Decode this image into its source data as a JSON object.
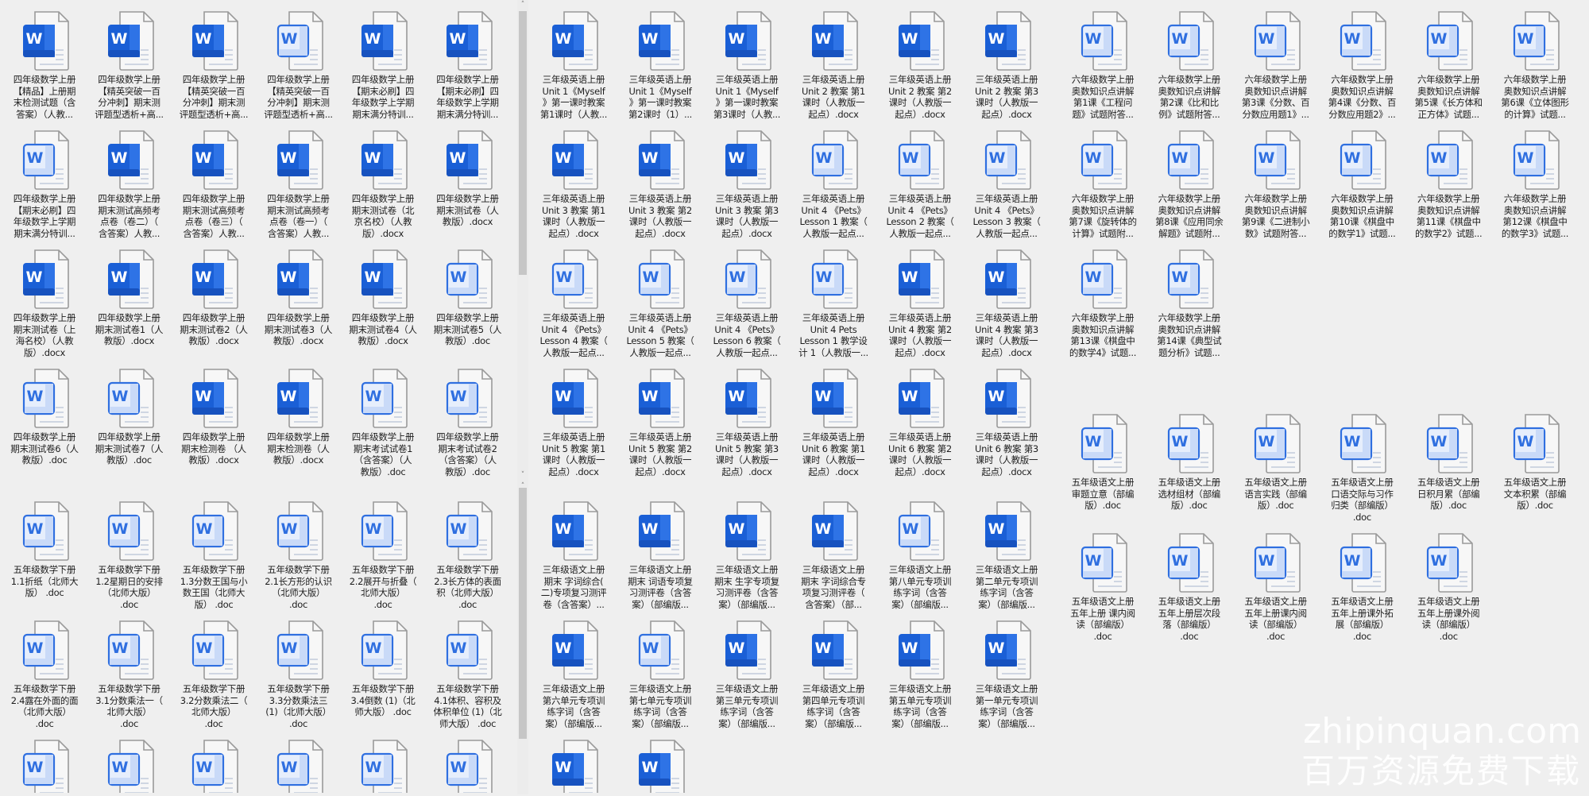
{
  "colors": {
    "background": "#efefef",
    "word_blue": "#1a5fd6",
    "word_blue_light": "#c9daf8",
    "outline_blue": "#2f6fe0"
  },
  "panes": [
    {
      "name": "left-top-pane",
      "rows": [
        [
          {
            "label": "四年级数学上册\n【精品】上册期\n末检测试题（含\n答案）（人教...",
            "icon": "word-solid-icon"
          },
          {
            "label": "四年级数学上册\n【精英突破一百\n分冲刺】期末测\n评题型透析+高...",
            "icon": "word-solid-icon"
          },
          {
            "label": "四年级数学上册\n【精英突破一百\n分冲刺】期末测\n评题型透析+高...",
            "icon": "word-solid-icon"
          },
          {
            "label": "四年级数学上册\n【精英突破一百\n分冲刺】期末测\n评题型透析+高...",
            "icon": "word-outline-icon"
          },
          {
            "label": "四年级数学上册\n【期末必刷】四\n年级数学上学期\n期末满分特训...",
            "icon": "word-solid-icon"
          },
          {
            "label": "四年级数学上册\n【期末必刷】四\n年级数学上学期\n期末满分特训...",
            "icon": "word-solid-icon"
          }
        ],
        [
          {
            "label": "四年级数学上册\n【期末必刷】四\n年级数学上学期\n期末满分特训...",
            "icon": "word-outline-icon"
          },
          {
            "label": "四年级数学上册\n期末测试高频考\n点卷（卷二）（\n含答案）人教...",
            "icon": "word-solid-icon"
          },
          {
            "label": "四年级数学上册\n期末测试高频考\n点卷（卷三）（\n含答案）人教...",
            "icon": "word-solid-icon"
          },
          {
            "label": "四年级数学上册\n期末测试高频考\n点卷（卷一）（\n含答案）人教...",
            "icon": "word-solid-icon"
          },
          {
            "label": "四年级数学上册\n期末测试卷（北\n京名校）（人教\n版）.docx",
            "icon": "word-solid-icon"
          },
          {
            "label": "四年级数学上册\n期末测试卷（人\n教版）.docx",
            "icon": "word-solid-icon"
          }
        ],
        [
          {
            "label": "四年级数学上册\n期末测试卷（上\n海名校）（人教\n版）.docx",
            "icon": "word-solid-icon"
          },
          {
            "label": "四年级数学上册\n期末测试卷1（人\n教版）.docx",
            "icon": "word-solid-icon"
          },
          {
            "label": "四年级数学上册\n期末测试卷2（人\n教版）.docx",
            "icon": "word-solid-icon"
          },
          {
            "label": "四年级数学上册\n期末测试卷3（人\n教版）.docx",
            "icon": "word-solid-icon"
          },
          {
            "label": "四年级数学上册\n期末测试卷4（人\n教版）.docx",
            "icon": "word-solid-icon"
          },
          {
            "label": "四年级数学上册\n期末测试卷5（人\n教版）.doc",
            "icon": "word-outline-icon"
          }
        ],
        [
          {
            "label": "四年级数学上册\n期末测试卷6（人\n教版）.doc",
            "icon": "word-outline-icon"
          },
          {
            "label": "四年级数学上册\n期末测试卷7（人\n教版）.doc",
            "icon": "word-outline-icon"
          },
          {
            "label": "四年级数学上册\n期末检测卷 （人\n教版）.docx",
            "icon": "word-solid-icon"
          },
          {
            "label": "四年级数学上册\n期末检测卷（人\n教版）.docx",
            "icon": "word-solid-icon"
          },
          {
            "label": "四年级数学上册\n期末考试试卷1\n（含答案）（人\n教版）.doc",
            "icon": "word-outline-icon"
          },
          {
            "label": "四年级数学上册\n期末考试试卷2\n（含答案）（人\n教版）.doc",
            "icon": "word-outline-icon"
          }
        ]
      ]
    },
    {
      "name": "left-bottom-pane",
      "rows": [
        [
          {
            "label": "五年级数学下册\n1.1折纸（北师大\n版） .doc",
            "icon": "word-outline-icon"
          },
          {
            "label": "五年级数学下册\n1.2星期日的安排\n（北师大版）\n.doc",
            "icon": "word-outline-icon"
          },
          {
            "label": "五年级数学下册\n1.3分数王国与小\n数王国（北师大\n版） .doc",
            "icon": "word-outline-icon"
          },
          {
            "label": "五年级数学下册\n2.1长方形的认识\n（北师大版）\n.doc",
            "icon": "word-outline-icon"
          },
          {
            "label": "五年级数学下册\n2.2展开与折叠（\n北师大版）\n.doc",
            "icon": "word-outline-icon"
          },
          {
            "label": "五年级数学下册\n2.3长方体的表面\n积（北师大版）\n.doc",
            "icon": "word-outline-icon"
          }
        ],
        [
          {
            "label": "五年级数学下册\n2.4露在外面的面\n（北师大版）\n.doc",
            "icon": "word-outline-icon"
          },
          {
            "label": "五年级数学下册\n3.1分数乘法一（\n北师大版）\n.doc",
            "icon": "word-outline-icon"
          },
          {
            "label": "五年级数学下册\n3.2分数乘法二（\n北师大版）\n.doc",
            "icon": "word-outline-icon"
          },
          {
            "label": "五年级数学下册\n3.3分数乘法三\n(1)（北师大版）\n.doc",
            "icon": "word-outline-icon"
          },
          {
            "label": "五年级数学下册\n3.4倒数 (1)（北\n师大版） .doc",
            "icon": "word-outline-icon"
          },
          {
            "label": "五年级数学下册\n4.1体积、容积及\n体积单位 (1)（北\n师大版） .doc",
            "icon": "word-outline-icon"
          }
        ],
        [
          {
            "icon": "word-outline-icon"
          },
          {
            "icon": "word-outline-icon"
          },
          {
            "icon": "word-outline-icon"
          },
          {
            "icon": "word-outline-icon"
          },
          {
            "icon": "word-outline-icon"
          },
          {
            "icon": "word-outline-icon"
          }
        ]
      ]
    },
    {
      "name": "middle-top-pane",
      "rows": [
        [
          {
            "label": "三年级英语上册\nUnit 1《Myself\n》第一课时教案\n第1课时（人教...",
            "icon": "word-solid-icon"
          },
          {
            "label": "三年级英语上册\nUnit 1《Myself\n》第一课时教案\n第2课时（1）...",
            "icon": "word-solid-icon"
          },
          {
            "label": "三年级英语上册\nUnit 1《Myself\n》第一课时教案\n第3课时（人教...",
            "icon": "word-solid-icon"
          },
          {
            "label": "三年级英语上册\nUnit 2 教案 第1\n课时（人教版一\n起点）.docx",
            "icon": "word-solid-icon"
          },
          {
            "label": "三年级英语上册\nUnit 2 教案 第2\n课时（人教版一\n起点）.docx",
            "icon": "word-solid-icon"
          },
          {
            "label": "三年级英语上册\nUnit 2 教案 第3\n课时（人教版一\n起点）.docx",
            "icon": "word-solid-icon"
          }
        ],
        [
          {
            "label": "三年级英语上册\nUnit 3 教案 第1\n课时（人教版一\n起点）.docx",
            "icon": "word-solid-icon"
          },
          {
            "label": "三年级英语上册\nUnit 3 教案 第2\n课时（人教版一\n起点）.docx",
            "icon": "word-solid-icon"
          },
          {
            "label": "三年级英语上册\nUnit 3 教案 第3\n课时（人教版一\n起点）.docx",
            "icon": "word-solid-icon"
          },
          {
            "label": "三年级英语上册\nUnit 4 《Pets》\nLesson 1 教案（\n人教版一起点...",
            "icon": "word-outline-icon"
          },
          {
            "label": "三年级英语上册\nUnit 4 《Pets》\nLesson 2 教案（\n人教版一起点...",
            "icon": "word-outline-icon"
          },
          {
            "label": "三年级英语上册\nUnit 4 《Pets》\nLesson 3 教案（\n人教版一起点...",
            "icon": "word-outline-icon"
          }
        ],
        [
          {
            "label": "三年级英语上册\nUnit 4 《Pets》\nLesson 4 教案（\n人教版一起点...",
            "icon": "word-outline-icon"
          },
          {
            "label": "三年级英语上册\nUnit 4 《Pets》\nLesson 5 教案（\n人教版一起点...",
            "icon": "word-outline-icon"
          },
          {
            "label": "三年级英语上册\nUnit 4 《Pets》\nLesson 6 教案（\n人教版一起点...",
            "icon": "word-outline-icon"
          },
          {
            "label": "三年级英语上册\nUnit 4 Pets\nLesson 1 教学设\n计 1（人教版一...",
            "icon": "word-outline-icon"
          },
          {
            "label": "三年级英语上册\nUnit 4 教案 第2\n课时（人教版一\n起点）.docx",
            "icon": "word-solid-icon"
          },
          {
            "label": "三年级英语上册\nUnit 4 教案 第3\n课时（人教版一\n起点）.docx",
            "icon": "word-solid-icon"
          }
        ],
        [
          {
            "label": "三年级英语上册\nUnit 5 教案 第1\n课时（人教版一\n起点）.docx",
            "icon": "word-solid-icon"
          },
          {
            "label": "三年级英语上册\nUnit 5 教案 第2\n课时（人教版一\n起点）.docx",
            "icon": "word-solid-icon"
          },
          {
            "label": "三年级英语上册\nUnit 5 教案 第3\n课时（人教版一\n起点）.docx",
            "icon": "word-solid-icon"
          },
          {
            "label": "三年级英语上册\nUnit 6 教案 第1\n课时（人教版一\n起点）.docx",
            "icon": "word-solid-icon"
          },
          {
            "label": "三年级英语上册\nUnit 6 教案 第2\n课时（人教版一\n起点）.docx",
            "icon": "word-solid-icon"
          },
          {
            "label": "三年级英语上册\nUnit 6 教案 第3\n课时（人教版一\n起点）.docx",
            "icon": "word-solid-icon"
          }
        ]
      ]
    },
    {
      "name": "middle-bottom-pane",
      "rows": [
        [
          {
            "label": "三年级语文上册\n期末 字词综合(\n二)专项复习测评\n卷（含答案）...",
            "icon": "word-solid-icon"
          },
          {
            "label": "三年级语文上册\n期末 词语专项复\n习测评卷（含答\n案）（部编版...",
            "icon": "word-solid-icon"
          },
          {
            "label": "三年级语文上册\n期末 生字专项复\n习测评卷（含答\n案）（部编版...",
            "icon": "word-solid-icon"
          },
          {
            "label": "三年级语文上册\n期末 字词综合专\n项复习测评卷（\n含答案）（部...",
            "icon": "word-solid-icon"
          },
          {
            "label": "三年级语文上册\n第八单元专项训\n练字词（含答\n案）（部编版...",
            "icon": "word-outline-icon"
          },
          {
            "label": "三年级语文上册\n第二单元专项训\n练字词（含答\n案）（部编版...",
            "icon": "word-solid-icon"
          }
        ],
        [
          {
            "label": "三年级语文上册\n第六单元专项训\n练字词（含答\n案）（部编版...",
            "icon": "word-solid-icon"
          },
          {
            "label": "三年级语文上册\n第七单元专项训\n练字词（含答\n案）（部编版...",
            "icon": "word-outline-icon"
          },
          {
            "label": "三年级语文上册\n第三单元专项训\n练字词（含答\n案）（部编版...",
            "icon": "word-solid-icon"
          },
          {
            "label": "三年级语文上册\n第四单元专项训\n练字词（含答\n案）（部编版...",
            "icon": "word-solid-icon"
          },
          {
            "label": "三年级语文上册\n第五单元专项训\n练字词（含答\n案）（部编版...",
            "icon": "word-solid-icon"
          },
          {
            "label": "三年级语文上册\n第一单元专项训\n练字词（含答\n案）（部编版...",
            "icon": "word-solid-icon"
          }
        ],
        [
          {
            "icon": "word-solid-icon"
          },
          {
            "icon": "word-solid-icon"
          }
        ]
      ]
    },
    {
      "name": "right-top-pane",
      "rows": [
        [
          {
            "label": "六年级数学上册\n奥数知识点讲解\n第1课《工程问\n题》试题附答...",
            "icon": "word-outline-icon"
          },
          {
            "label": "六年级数学上册\n奥数知识点讲解\n第2课《比和比\n例》试题附答...",
            "icon": "word-outline-icon"
          },
          {
            "label": "六年级数学上册\n奥数知识点讲解\n第3课《分数、百\n分数应用题1》...",
            "icon": "word-outline-icon"
          },
          {
            "label": "六年级数学上册\n奥数知识点讲解\n第4课《分数、百\n分数应用题2》...",
            "icon": "word-outline-icon"
          },
          {
            "label": "六年级数学上册\n奥数知识点讲解\n第5课《长方体和\n正方体》试题...",
            "icon": "word-outline-icon"
          },
          {
            "label": "六年级数学上册\n奥数知识点讲解\n第6课《立体图形\n的计算》试题...",
            "icon": "word-outline-icon"
          }
        ],
        [
          {
            "label": "六年级数学上册\n奥数知识点讲解\n第7课《旋转体的\n计算》试题附...",
            "icon": "word-outline-icon"
          },
          {
            "label": "六年级数学上册\n奥数知识点讲解\n第8课《应用同余\n解题》试题附...",
            "icon": "word-outline-icon"
          },
          {
            "label": "六年级数学上册\n奥数知识点讲解\n第9课《二进制小\n数》试题附答...",
            "icon": "word-outline-icon"
          },
          {
            "label": "六年级数学上册\n奥数知识点讲解\n第10课《棋盘中\n的数学1》试题...",
            "icon": "word-outline-icon"
          },
          {
            "label": "六年级数学上册\n奥数知识点讲解\n第11课《棋盘中\n的数学2》试题...",
            "icon": "word-outline-icon"
          },
          {
            "label": "六年级数学上册\n奥数知识点讲解\n第12课《棋盘中\n的数学3》试题...",
            "icon": "word-outline-icon"
          }
        ],
        [
          {
            "label": "六年级数学上册\n奥数知识点讲解\n第13课《棋盘中\n的数学4》试题...",
            "icon": "word-outline-icon"
          },
          {
            "label": "六年级数学上册\n奥数知识点讲解\n第14课《典型试\n题分析》试题...",
            "icon": "word-outline-icon"
          }
        ]
      ]
    },
    {
      "name": "right-bottom-pane",
      "rows": [
        [
          {
            "label": "五年级语文上册\n审题立意（部编\n版）.doc",
            "icon": "word-outline-icon"
          },
          {
            "label": "五年级语文上册\n选材组材（部编\n版）.doc",
            "icon": "word-outline-icon"
          },
          {
            "label": "五年级语文上册\n语言实践（部编\n版）.doc",
            "icon": "word-outline-icon"
          },
          {
            "label": "五年级语文上册\n口语交际与习作\n归类（部编版）\n.doc",
            "icon": "word-outline-icon"
          },
          {
            "label": "五年级语文上册\n日积月累（部编\n版）.doc",
            "icon": "word-outline-icon"
          },
          {
            "label": "五年级语文上册\n文本积累（部编\n版）.doc",
            "icon": "word-outline-icon"
          }
        ],
        [
          {
            "label": "五年级语文上册\n五年上册 课内阅\n读（部编版）\n.doc",
            "icon": "word-outline-icon"
          },
          {
            "label": "五年级语文上册\n五年上册层次段\n落（部编版）\n.doc",
            "icon": "word-outline-icon"
          },
          {
            "label": "五年级语文上册\n五年上册课内阅\n读（部编版）\n.doc",
            "icon": "word-outline-icon"
          },
          {
            "label": "五年级语文上册\n五年上册课外拓\n展（部编版）\n.doc",
            "icon": "word-outline-icon"
          },
          {
            "label": "五年级语文上册\n五年上册课外阅\n读（部编版）\n.doc",
            "icon": "word-outline-icon"
          }
        ]
      ]
    }
  ],
  "scrollbar": {
    "up_arrow": "˄",
    "down_arrow": "˅"
  },
  "watermark": {
    "line1": "zhipinquan.com",
    "line2": "百万资源免费下载"
  }
}
